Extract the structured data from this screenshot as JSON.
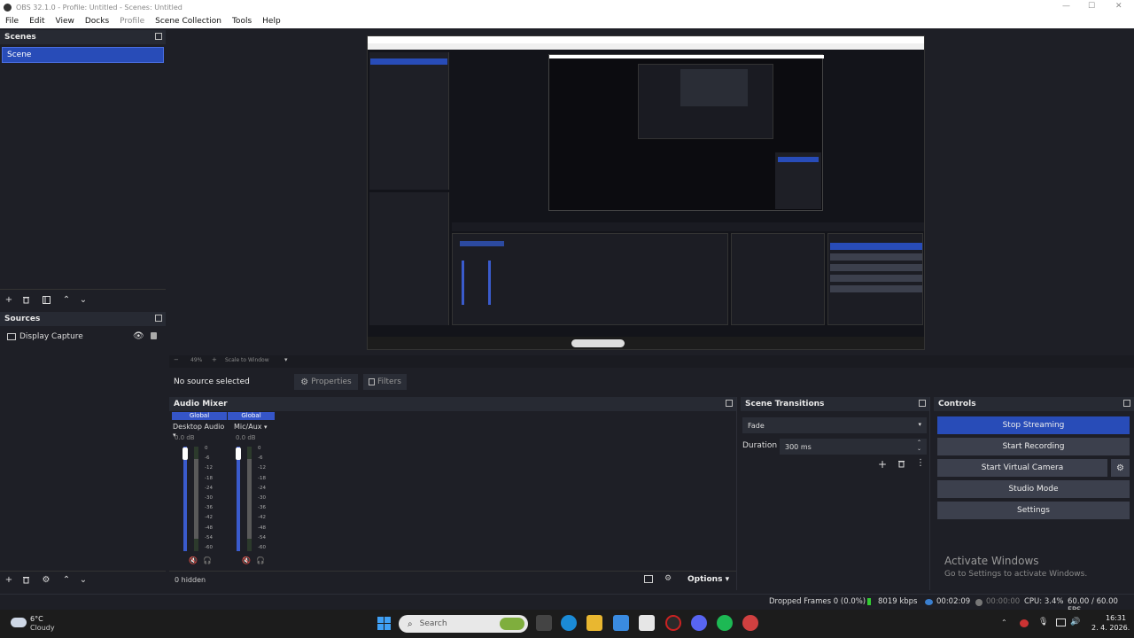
{
  "window": {
    "title": "OBS 32.1.0 - Profile: Untitled - Scenes: Untitled",
    "controls": [
      "—",
      "☐",
      "✕"
    ]
  },
  "menu": [
    {
      "label": "File",
      "enabled": true
    },
    {
      "label": "Edit",
      "enabled": true
    },
    {
      "label": "View",
      "enabled": true
    },
    {
      "label": "Docks",
      "enabled": true
    },
    {
      "label": "Profile",
      "enabled": false
    },
    {
      "label": "Scene Collection",
      "enabled": true
    },
    {
      "label": "Tools",
      "enabled": true
    },
    {
      "label": "Help",
      "enabled": true
    }
  ],
  "scenes": {
    "title": "Scenes",
    "items": [
      "Scene"
    ],
    "selected": 0
  },
  "sources": {
    "title": "Sources",
    "items": [
      {
        "name": "Display Capture",
        "visible": true,
        "locked": true
      }
    ]
  },
  "preview": {
    "zoom": "49%",
    "scale_mode": "Scale to Window"
  },
  "context_bar": {
    "no_source": "No source selected",
    "properties": "Properties",
    "filters": "Filters"
  },
  "audio_mixer": {
    "title": "Audio Mixer",
    "channels": [
      {
        "badge": "Global",
        "name": "Desktop Audio",
        "db": "0.0 dB"
      },
      {
        "badge": "Global",
        "name": "Mic/Aux",
        "db": "0.0 dB"
      }
    ],
    "scale": [
      "0",
      "-6",
      "-12",
      "-18",
      "-24",
      "-30",
      "-36",
      "-42",
      "-48",
      "-54",
      "-60"
    ],
    "hidden": "0 hidden",
    "options": "Options"
  },
  "scene_transitions": {
    "title": "Scene Transitions",
    "transition": "Fade",
    "duration_label": "Duration",
    "duration_value": "300 ms"
  },
  "controls": {
    "title": "Controls",
    "buttons": [
      "Stop Streaming",
      "Start Recording",
      "Start Virtual Camera",
      "Studio Mode",
      "Settings"
    ]
  },
  "watermark": {
    "title": "Activate Windows",
    "subtitle": "Go to Settings to activate Windows."
  },
  "status": {
    "dropped": "Dropped Frames 0 (0.0%)",
    "bitrate": "8019 kbps",
    "stream_time": "00:02:09",
    "rec_time": "00:00:00",
    "cpu": "CPU: 3.4%",
    "fps": "60.00 / 60.00 FPS"
  },
  "taskbar": {
    "weather_temp": "6°C",
    "weather_desc": "Cloudy",
    "search": "Search",
    "time": "16:31",
    "date": "2. 4. 2026."
  },
  "colors": {
    "accent": "#284cb8",
    "panel_bg": "#1e1f26",
    "header_bg": "#272a33",
    "button_bg": "#3c404d"
  }
}
